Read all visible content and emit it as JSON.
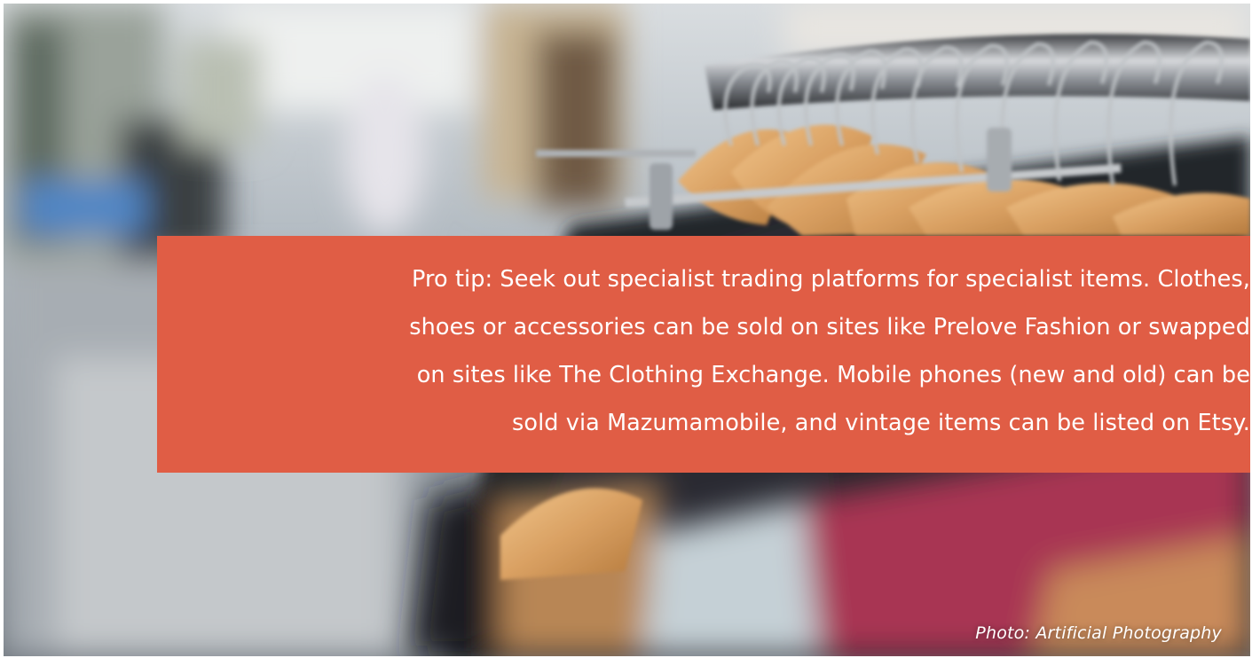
{
  "colors": {
    "accent": "#e05d45",
    "text_on_accent": "#ffffff"
  },
  "photo_subject": "clothing rack with wooden hangers",
  "tip": {
    "lines": [
      "Pro tip: Seek out specialist trading platforms for specialist items. Clothes,",
      "shoes or accessories can be sold on sites like Prelove Fashion or swapped",
      "on sites like The Clothing Exchange. Mobile phones (new and old) can be",
      "sold via Mazumamobile, and vintage items can be listed on Etsy."
    ]
  },
  "credit": "Photo: Artificial Photography"
}
